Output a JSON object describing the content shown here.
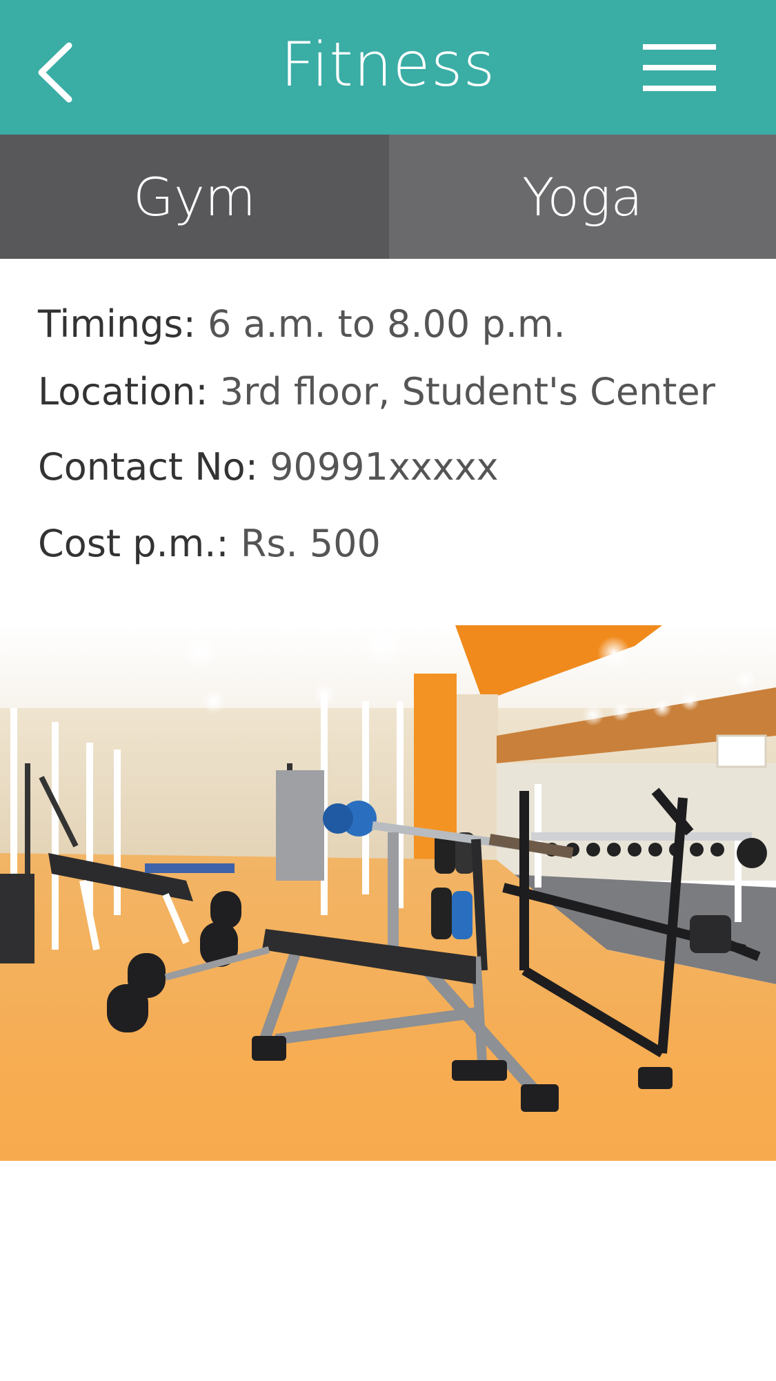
{
  "header": {
    "title": "Fitness",
    "back_icon": "chevron-left-icon",
    "menu_icon": "hamburger-menu-icon",
    "color": "#3aada5"
  },
  "tabs": [
    {
      "label": "Gym",
      "color": "#58585a"
    },
    {
      "label": "Yoga",
      "color": "#6a6a6c"
    }
  ],
  "info": {
    "timings": {
      "label": "Timings:",
      "value": "6 a.m. to 8.00 p.m."
    },
    "location": {
      "label": "Location:",
      "value": "3rd floor, Student's Center"
    },
    "contact": {
      "label": "Contact No:",
      "value": "90991xxxxx"
    },
    "cost": {
      "label": "Cost p.m.:",
      "value": "Rs. 500"
    }
  },
  "photo": {
    "subject": "gym-interior-photo"
  }
}
